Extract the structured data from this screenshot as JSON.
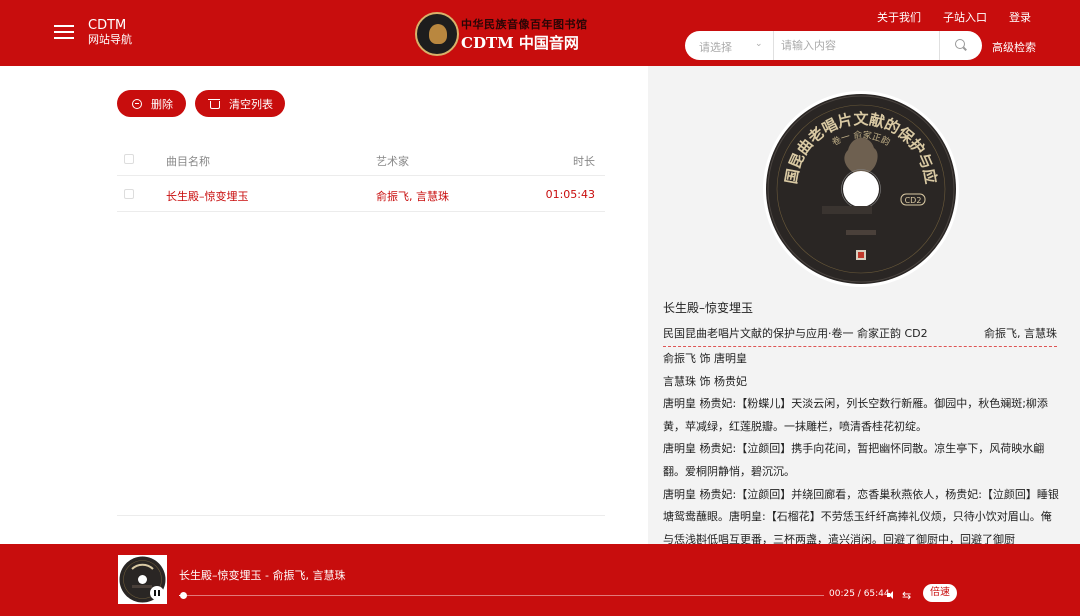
{
  "header": {
    "site_name": "CDTM",
    "site_subtitle": "网站导航",
    "logo_top": "中华民族音像百年图书馆",
    "logo_main": "CDTM 中国音网",
    "top_links": [
      "关于我们",
      "子站入口",
      "登录"
    ],
    "search_select": "请选择",
    "search_placeholder": "请输入内容",
    "advanced_search": "高级检索"
  },
  "playlist": {
    "delete_label": "删除",
    "clear_label": "清空列表",
    "columns": {
      "name": "曲目名称",
      "artist": "艺术家",
      "duration": "时长"
    },
    "rows": [
      {
        "name": "长生殿–惊变埋玉",
        "artist": "俞振飞, 言慧珠",
        "duration": "01:05:43"
      }
    ]
  },
  "detail": {
    "disc_title": "民国昆曲老唱片文献的保护与应用",
    "disc_volume": "卷一 俞家正韵",
    "disc_label": "CD2",
    "song_title": "长生殿–惊变埋玉",
    "album": "民国昆曲老唱片文献的保护与应用·卷一 俞家正韵 CD2",
    "artists": "俞振飞, 言慧珠",
    "lyrics": [
      "俞振飞 饰 唐明皇",
      "言慧珠 饰 杨贵妃",
      "唐明皇 杨贵妃:【粉蝶儿】天淡云闲，列长空数行新雁。御园中，秋色斓斑;柳添黄，苹减绿，红莲脱瓣。一抹雕栏，喷清香桂花初绽。",
      "唐明皇 杨贵妃:【泣颜回】携手向花间，暂把幽怀同散。凉生亭下，风荷映水翩翻。爱桐阴静悄，碧沉沉。",
      "唐明皇 杨贵妃:【泣颜回】并绕回廊看，恋香巢秋燕依人，杨贵妃:【泣颜回】睡银塘鸳鸯蘸眼。唐明皇:【石榴花】不劳恁玉纤纤高捧礼仪烦，只待小饮对眉山。俺与恁浅斟低唱互更番，三杯两盏，遣兴消闲。回避了御厨中，回避了御厨"
    ]
  },
  "player": {
    "now_playing": "长生殿–惊变埋玉 - 俞振飞, 言慧珠",
    "time": "00:25 / 65:44",
    "progress": 0.0064,
    "speed_label": "倍速"
  },
  "colors": {
    "brand_red": "#c80d0d",
    "panel_gray": "#f3f3f3"
  }
}
